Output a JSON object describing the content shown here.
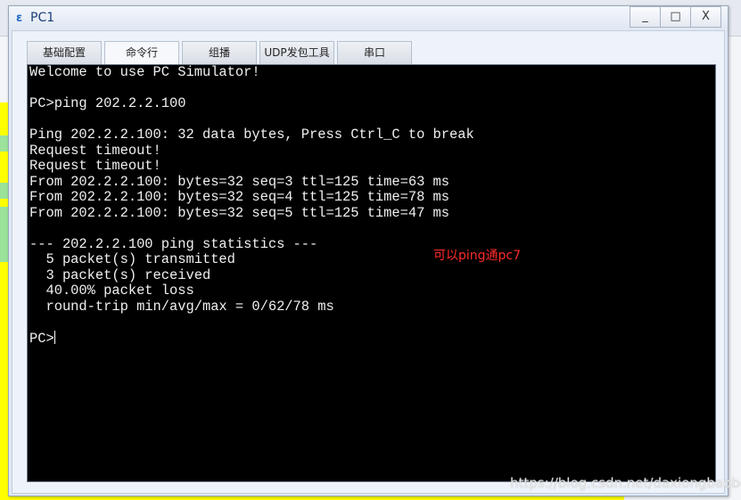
{
  "window": {
    "title": "PC1",
    "buttons": {
      "minimize": "_",
      "maximize": "□",
      "close": "X"
    }
  },
  "tabs": [
    {
      "label": "基础配置",
      "active": false
    },
    {
      "label": "命令行",
      "active": true
    },
    {
      "label": "组播",
      "active": false
    },
    {
      "label": "UDP发包工具",
      "active": false
    },
    {
      "label": "串口",
      "active": false
    }
  ],
  "terminal": {
    "lines": [
      "Welcome to use PC Simulator!",
      "",
      "PC>ping 202.2.2.100",
      "",
      "Ping 202.2.2.100: 32 data bytes, Press Ctrl_C to break",
      "Request timeout!",
      "Request timeout!",
      "From 202.2.2.100: bytes=32 seq=3 ttl=125 time=63 ms",
      "From 202.2.2.100: bytes=32 seq=4 ttl=125 time=78 ms",
      "From 202.2.2.100: bytes=32 seq=5 ttl=125 time=47 ms",
      "",
      "--- 202.2.2.100 ping statistics ---",
      "  5 packet(s) transmitted",
      "  3 packet(s) received",
      "  40.00% packet loss",
      "  round-trip min/avg/max = 0/62/78 ms",
      "",
      "PC>"
    ]
  },
  "annotation": "可以ping通pc7",
  "watermark": "https://blog.csdn.net/daxiongbaobei",
  "colors": {
    "terminal_bg": "#000000",
    "terminal_fg": "#f0f0f0",
    "annotation": "#ff2a2a"
  }
}
